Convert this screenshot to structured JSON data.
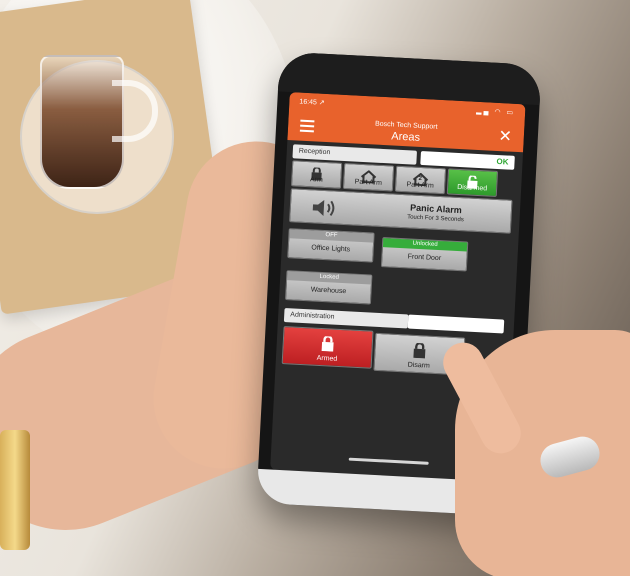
{
  "status": {
    "time": "16:45 ↗",
    "icons": "▂▄ ◠ ▭"
  },
  "app": {
    "subtitle": "Bosch Tech Support",
    "title": "Areas"
  },
  "areas": [
    {
      "name": "Reception",
      "status": "OK",
      "buttons": [
        {
          "label": "Arm",
          "icon": "lock-icon"
        },
        {
          "label": "Part Arm",
          "icon": "house-icon"
        },
        {
          "label": "Part Arm",
          "icon": "house-2-icon",
          "badge": "2"
        },
        {
          "label": "Disarmed",
          "icon": "unlock-icon",
          "active": true
        }
      ]
    },
    {
      "name": "Administration",
      "status": "",
      "buttons": [
        {
          "label": "Armed",
          "icon": "lock-icon",
          "active": true
        },
        {
          "label": "Disarm",
          "icon": "lock-icon"
        }
      ]
    }
  ],
  "panic": {
    "title": "Panic Alarm",
    "subtitle": "Touch For 3 Seconds"
  },
  "outputs": [
    {
      "tag": "OFF",
      "label": "Office Lights"
    },
    {
      "tag": "Unlocked",
      "label": "Front Door"
    },
    {
      "tag": "Locked",
      "label": "Warehouse"
    }
  ],
  "colors": {
    "header": "#e8622c",
    "ok": "#2fa733",
    "armed": "#d42f2f",
    "disarmed": "#3aa936"
  }
}
